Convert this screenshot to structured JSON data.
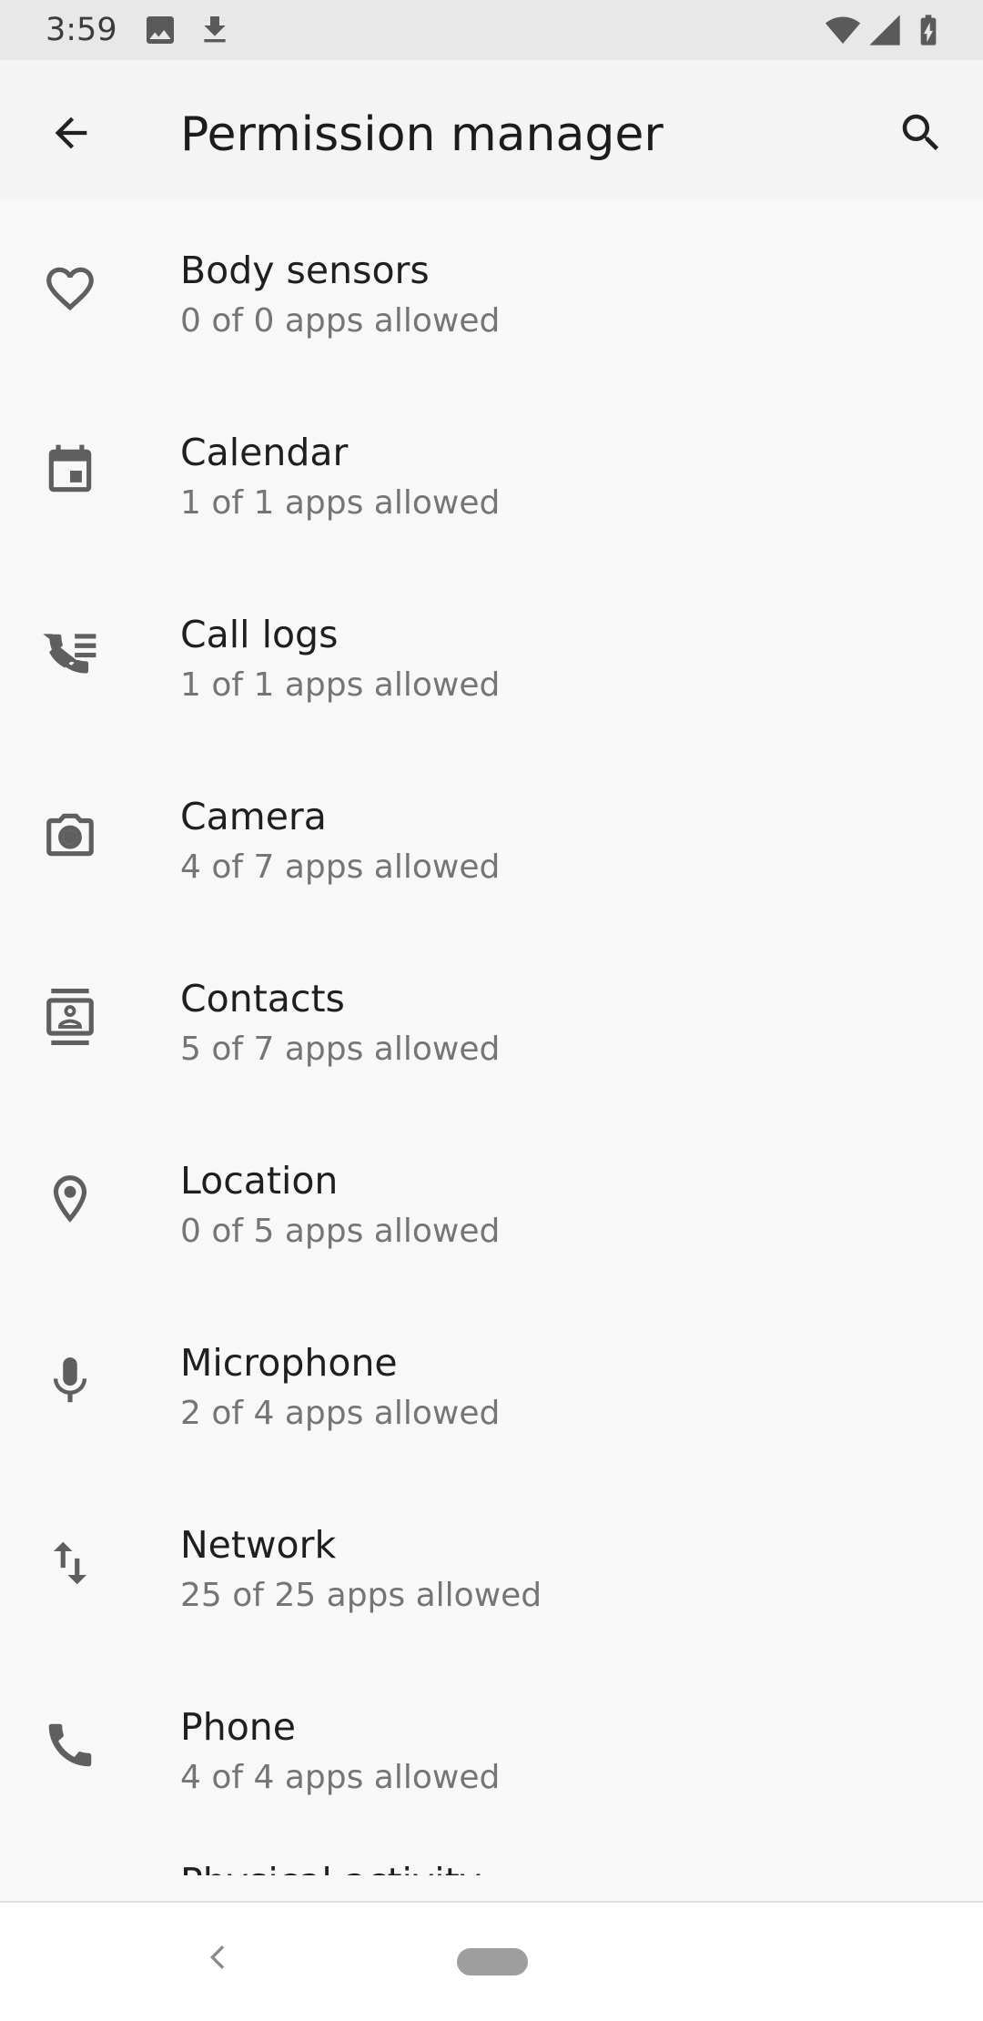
{
  "status_bar": {
    "time": "3:59",
    "icons_left": [
      "image-icon",
      "download-icon"
    ],
    "icons_right": [
      "wifi-icon",
      "signal-icon",
      "battery-charging-icon"
    ]
  },
  "app_bar": {
    "title": "Permission manager",
    "back_icon": "arrow-back-icon",
    "search_icon": "search-icon"
  },
  "permissions": [
    {
      "label": "Body sensors",
      "subtitle": "0 of 0 apps allowed",
      "icon": "heart-icon"
    },
    {
      "label": "Calendar",
      "subtitle": "1 of 1 apps allowed",
      "icon": "calendar-icon"
    },
    {
      "label": "Call logs",
      "subtitle": "1 of 1 apps allowed",
      "icon": "call-log-icon"
    },
    {
      "label": "Camera",
      "subtitle": "4 of 7 apps allowed",
      "icon": "camera-icon"
    },
    {
      "label": "Contacts",
      "subtitle": "5 of 7 apps allowed",
      "icon": "contacts-icon"
    },
    {
      "label": "Location",
      "subtitle": "0 of 5 apps allowed",
      "icon": "location-pin-icon"
    },
    {
      "label": "Microphone",
      "subtitle": "2 of 4 apps allowed",
      "icon": "microphone-icon"
    },
    {
      "label": "Network",
      "subtitle": "25 of 25 apps allowed",
      "icon": "swap-vertical-icon"
    },
    {
      "label": "Phone",
      "subtitle": "4 of 4 apps allowed",
      "icon": "phone-icon"
    }
  ],
  "partial_item": {
    "label": "Physical activity"
  },
  "nav_bar": {
    "back_icon": "nav-back-chevron-icon",
    "home_icon": "home-pill-icon"
  },
  "colors": {
    "background": "#f8f8f8",
    "app_bar": "#f4f4f4",
    "status_bar": "#e8e8e8",
    "primary_text": "#1f1f1f",
    "secondary_text": "#757575",
    "icon": "#5f5f5f"
  }
}
